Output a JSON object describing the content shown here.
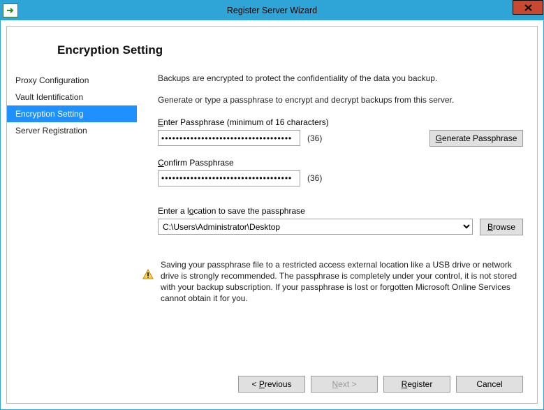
{
  "window": {
    "title": "Register Server Wizard"
  },
  "heading": "Encryption Setting",
  "sidebar": {
    "items": [
      {
        "label": "Proxy Configuration",
        "selected": false
      },
      {
        "label": "Vault Identification",
        "selected": false
      },
      {
        "label": "Encryption Setting",
        "selected": true
      },
      {
        "label": "Server Registration",
        "selected": false
      }
    ]
  },
  "main": {
    "desc1": "Backups are encrypted to protect the confidentiality of the data you backup.",
    "desc2": "Generate or type a passphrase to encrypt and decrypt backups from this server.",
    "enter_label_pre": "E",
    "enter_label_post": "nter Passphrase (minimum of 16 characters)",
    "enter_value": "••••••••••••••••••••••••••••••••••••",
    "enter_count": "(36)",
    "gen_pre": "G",
    "gen_post": "enerate Passphrase",
    "confirm_label_pre": "C",
    "confirm_label_post": "onfirm Passphrase",
    "confirm_value": "••••••••••••••••••••••••••••••••••••",
    "confirm_count": "(36)",
    "location_label_pre": "Enter a l",
    "location_label_u": "o",
    "location_label_post": "cation to save the passphrase",
    "location_value": "C:\\Users\\Administrator\\Desktop",
    "browse_u": "B",
    "browse_post": "rowse",
    "warning": "Saving your passphrase file to a restricted access external location like a USB drive or network drive is strongly recommended. The passphrase is completely under your control, it is not stored with your backup subscription. If your passphrase is lost or forgotten Microsoft Online Services cannot obtain it for you."
  },
  "footer": {
    "prev_pre": "< ",
    "prev_u": "P",
    "prev_post": "revious",
    "next_u": "N",
    "next_post": "ext >",
    "register_u": "R",
    "register_post": "egister",
    "cancel": "Cancel"
  }
}
